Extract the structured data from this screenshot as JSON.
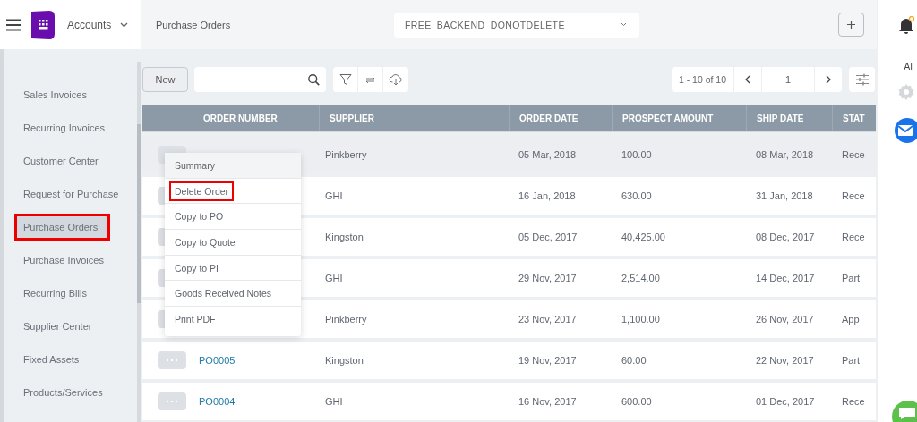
{
  "app": {
    "module": "Accounts",
    "page_title": "Purchase Orders",
    "company": "FREE_BACKEND_DONOTDELETE"
  },
  "rail": {
    "ai_label": "AI",
    "notification": true
  },
  "sidebar": {
    "items": [
      {
        "label": "Sales Invoices",
        "selected": false,
        "highlighted": false
      },
      {
        "label": "Recurring Invoices",
        "selected": false,
        "highlighted": false
      },
      {
        "label": "Customer Center",
        "selected": false,
        "highlighted": false
      },
      {
        "label": "Request for Purchase",
        "selected": false,
        "highlighted": false
      },
      {
        "label": "Purchase Orders",
        "selected": true,
        "highlighted": true
      },
      {
        "label": "Purchase Invoices",
        "selected": false,
        "highlighted": false
      },
      {
        "label": "Recurring Bills",
        "selected": false,
        "highlighted": false
      },
      {
        "label": "Supplier Center",
        "selected": false,
        "highlighted": false
      },
      {
        "label": "Fixed Assets",
        "selected": false,
        "highlighted": false
      },
      {
        "label": "Products/Services",
        "selected": false,
        "highlighted": false
      }
    ]
  },
  "toolbar": {
    "new_button": "New",
    "range": "1 - 10 of 10",
    "page": "1"
  },
  "table": {
    "columns": [
      "ORDER NUMBER",
      "SUPPLIER",
      "ORDER DATE",
      "PROSPECT AMOUNT",
      "SHIP DATE",
      "STAT"
    ],
    "rows": [
      {
        "supplier": "Pinkberry",
        "order_date": "05 Mar, 2018",
        "amount": "100.00",
        "ship_date": "08 Mar, 2018",
        "status": "Rece",
        "hovered": true
      },
      {
        "supplier": "GHI",
        "order_date": "16 Jan, 2018",
        "amount": "630.00",
        "ship_date": "31 Jan, 2018",
        "status": "Rece",
        "hovered": false
      },
      {
        "supplier": "Kingston",
        "order_date": "05 Dec, 2017",
        "amount": "40,425.00",
        "ship_date": "08 Dec, 2017",
        "status": "Rece",
        "hovered": false
      },
      {
        "supplier": "GHI",
        "order_date": "29 Nov, 2017",
        "amount": "2,514.00",
        "ship_date": "14 Dec, 2017",
        "status": "Part",
        "hovered": false
      },
      {
        "supplier": "Pinkberry",
        "order_date": "23 Nov, 2017",
        "amount": "1,100.00",
        "ship_date": "26 Nov, 2017",
        "status": "App",
        "hovered": false
      },
      {
        "order_number": "PO0005",
        "supplier": "Kingston",
        "order_date": "19 Nov, 2017",
        "amount": "60.00",
        "ship_date": "22 Nov, 2017",
        "status": "Part",
        "hovered": false
      },
      {
        "order_number": "PO0004",
        "supplier": "GHI",
        "order_date": "16 Nov, 2017",
        "amount": "600.00",
        "ship_date": "01 Dec, 2017",
        "status": "Rece",
        "hovered": false
      }
    ]
  },
  "context_menu": {
    "items": [
      {
        "label": "Summary",
        "hovered": true,
        "highlighted": false
      },
      {
        "label": "Delete Order",
        "hovered": false,
        "highlighted": true
      },
      {
        "label": "Copy to PO",
        "hovered": false,
        "highlighted": false
      },
      {
        "label": "Copy to Quote",
        "hovered": false,
        "highlighted": false
      },
      {
        "label": "Copy to PI",
        "hovered": false,
        "highlighted": false
      },
      {
        "label": "Goods Received Notes",
        "hovered": false,
        "highlighted": false
      },
      {
        "label": "Print PDF",
        "hovered": false,
        "highlighted": false
      }
    ]
  }
}
